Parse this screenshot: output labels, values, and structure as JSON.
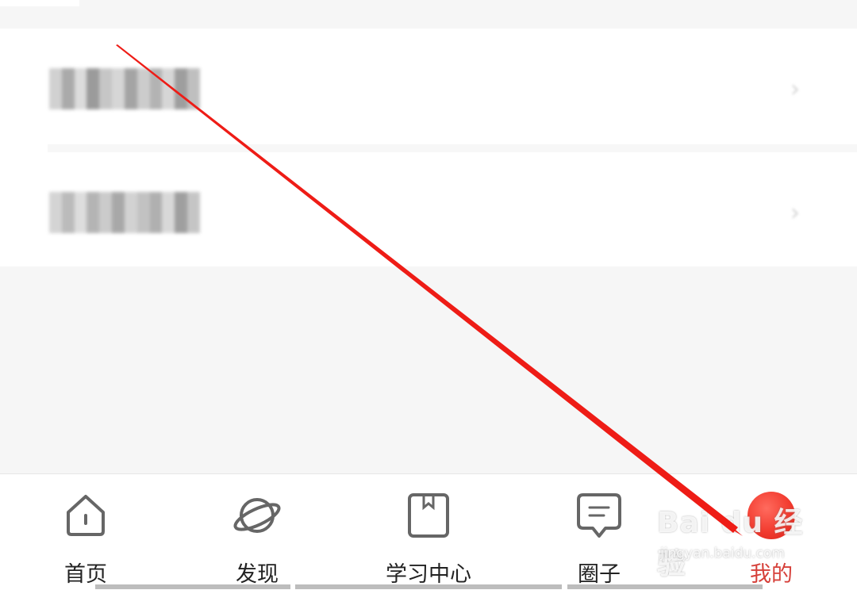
{
  "list": {
    "rows": [
      {
        "label_blurred": true,
        "chevron": "chevron-right-icon"
      },
      {
        "label_blurred": true,
        "chevron": "chevron-right-icon"
      }
    ]
  },
  "tabbar": {
    "tabs": [
      {
        "label": "首页",
        "icon": "home-icon",
        "active": false
      },
      {
        "label": "发现",
        "icon": "planet-icon",
        "active": false
      },
      {
        "label": "学习中心",
        "icon": "bookmark-book-icon",
        "active": false
      },
      {
        "label": "圈子",
        "icon": "chat-bubble-icon",
        "active": false
      },
      {
        "label": "我的",
        "icon": "profile-dot-icon",
        "active": true
      }
    ]
  },
  "colors": {
    "accent": "#d6403a",
    "annotation_arrow": "#ee1c16",
    "icon_stroke": "#666666",
    "background": "#f6f6f6"
  },
  "watermark": {
    "main": "Bai du 经验",
    "sub": "jingyan.baidu.com"
  }
}
